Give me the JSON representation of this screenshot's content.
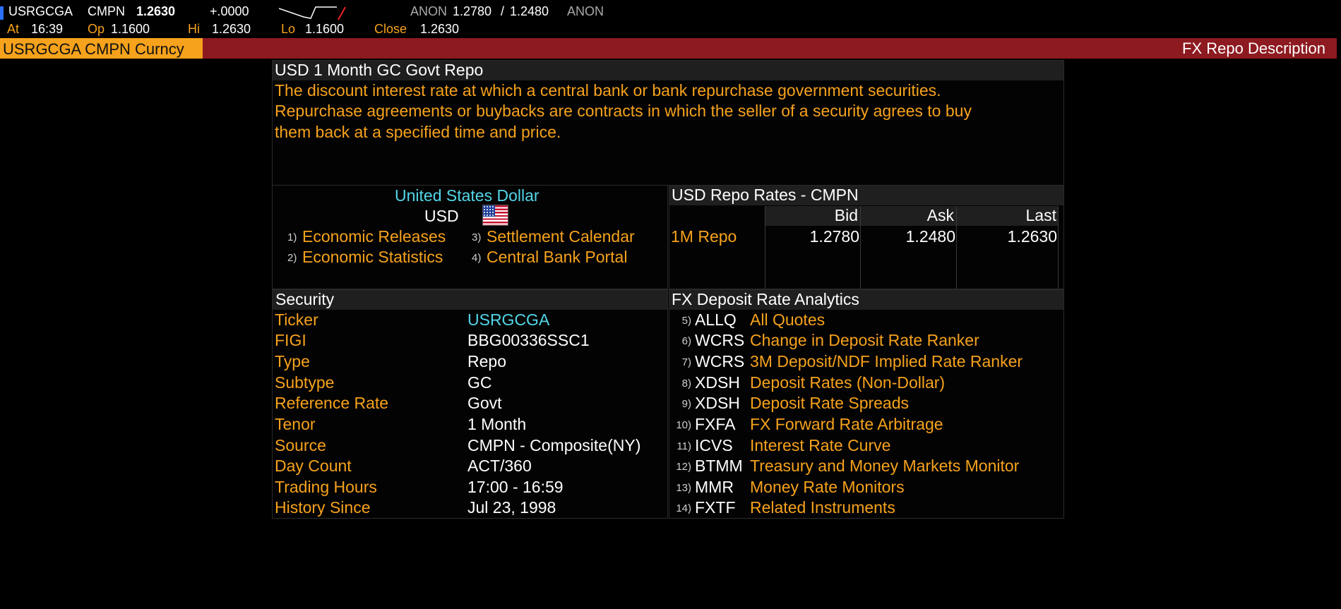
{
  "quote": {
    "ticker": "USRGCGA",
    "source": "CMPN",
    "last": "1.2630",
    "change": "+.0000",
    "bid_source": "ANON",
    "bid": "1.2780",
    "separator": "/",
    "ask": "1.2480",
    "ask_source": "ANON",
    "at_label": "At",
    "at_time": "16:39",
    "open_label": "Op",
    "open": "1.1600",
    "high_label": "Hi",
    "high": "1.2630",
    "low_label": "Lo",
    "low": "1.1600",
    "close_label": "Close",
    "close": "1.2630"
  },
  "header": {
    "security": "USRGCGA CMPN Curncy",
    "function_title": "FX Repo Description"
  },
  "description": {
    "title": "USD 1 Month GC Govt Repo",
    "lines": [
      "The discount interest rate at which a central bank or bank repurchase government securities.",
      "Repurchase agreements or buybacks are contracts in which the seller of a security agrees to buy",
      "them back at a specified time and price."
    ]
  },
  "currency": {
    "name": "United States Dollar",
    "code": "USD",
    "flag_icon": "us-flag-icon",
    "links": [
      {
        "num": "1)",
        "label": "Economic Releases"
      },
      {
        "num": "2)",
        "label": "Economic Statistics"
      },
      {
        "num": "3)",
        "label": "Settlement Calendar"
      },
      {
        "num": "4)",
        "label": "Central Bank Portal"
      }
    ]
  },
  "rates": {
    "title": "USD Repo Rates - CMPN",
    "columns": [
      "Bid",
      "Ask",
      "Last"
    ],
    "rows": [
      {
        "label": "1M Repo",
        "bid": "1.2780",
        "ask": "1.2480",
        "last": "1.2630"
      }
    ]
  },
  "security": {
    "title": "Security",
    "fields": [
      {
        "label": "Ticker",
        "value": "USRGCGA"
      },
      {
        "label": "FIGI",
        "value": "BBG00336SSC1"
      },
      {
        "label": "Type",
        "value": "Repo"
      },
      {
        "label": "Subtype",
        "value": "GC"
      },
      {
        "label": "Reference Rate",
        "value": "Govt"
      },
      {
        "label": "Tenor",
        "value": "1 Month"
      },
      {
        "label": "Source",
        "value": "CMPN - Composite(NY)"
      },
      {
        "label": "Day Count",
        "value": "ACT/360"
      },
      {
        "label": "Trading Hours",
        "value": "17:00 - 16:59"
      },
      {
        "label": "History Since",
        "value": "Jul 23, 1998"
      }
    ]
  },
  "analytics": {
    "title": "FX Deposit Rate Analytics",
    "items": [
      {
        "num": "5)",
        "code": "ALLQ",
        "label": "All Quotes"
      },
      {
        "num": "6)",
        "code": "WCRS",
        "label": "Change in Deposit Rate Ranker"
      },
      {
        "num": "7)",
        "code": "WCRS",
        "label": "3M Deposit/NDF Implied Rate Ranker"
      },
      {
        "num": "8)",
        "code": "XDSH",
        "label": "Deposit Rates (Non-Dollar)"
      },
      {
        "num": "9)",
        "code": "XDSH",
        "label": "Deposit Rate Spreads"
      },
      {
        "num": "10)",
        "code": "FXFA",
        "label": "FX Forward Rate Arbitrage"
      },
      {
        "num": "11)",
        "code": "ICVS",
        "label": "Interest Rate Curve"
      },
      {
        "num": "12)",
        "code": "BTMM",
        "label": "Treasury and Money Markets Monitor"
      },
      {
        "num": "13)",
        "code": "MMR",
        "label": "Money Rate Monitors"
      },
      {
        "num": "14)",
        "code": "FXTF",
        "label": "Related Instruments"
      }
    ]
  }
}
